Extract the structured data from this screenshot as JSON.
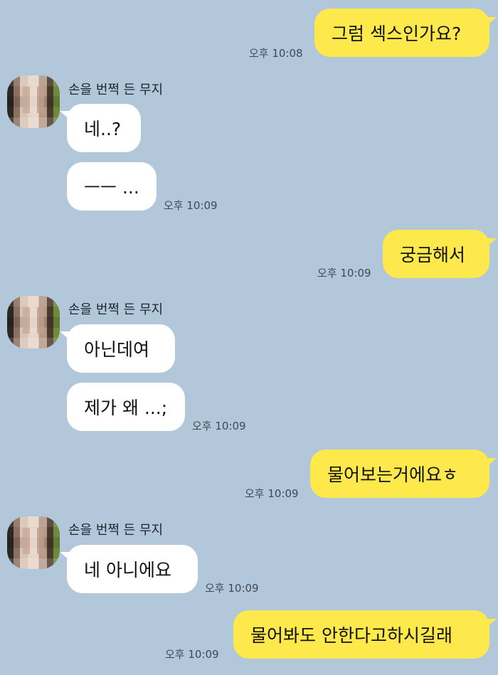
{
  "chat": {
    "messages": [
      {
        "sender": "me",
        "text": "그럼 섹스인가요?",
        "time": "오후 10:08"
      },
      {
        "sender": "other",
        "name": "손을 번쩍 든 무지",
        "texts": [
          "네..?",
          "ㅡㅡ ..."
        ],
        "time": "오후 10:09"
      },
      {
        "sender": "me",
        "text": "궁금해서",
        "time": "오후 10:09"
      },
      {
        "sender": "other",
        "name": "손을 번쩍 든 무지",
        "texts": [
          "아닌데여",
          "제가 왜 ...;"
        ],
        "time": "오후 10:09"
      },
      {
        "sender": "me",
        "text": "물어보는거에요ㅎ",
        "time": "오후 10:09"
      },
      {
        "sender": "other",
        "name": "손을 번쩍 든 무지",
        "texts": [
          "네 아니에요"
        ],
        "time": "오후 10:09"
      },
      {
        "sender": "me",
        "text": "물어봐도 안한다고하시길래",
        "time": "오후 10:09"
      }
    ]
  },
  "colors": {
    "background": "#b2c7da",
    "my_bubble": "#fee94c",
    "their_bubble": "#ffffff"
  }
}
